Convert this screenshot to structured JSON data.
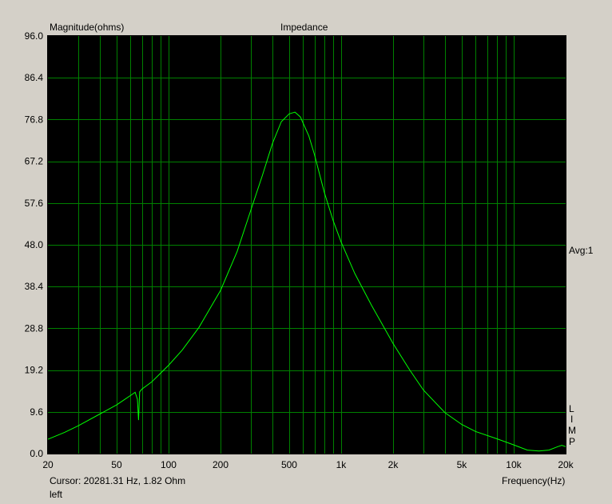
{
  "chart_data": {
    "type": "line",
    "title": "Impedance",
    "ylabel": "Magnitude(ohms)",
    "xlabel": "Frequency(Hz)",
    "x_scale": "log",
    "xlim": [
      20,
      20000
    ],
    "ylim": [
      0,
      96
    ],
    "grid": true,
    "y_ticks": [
      "0.0",
      "9.6",
      "19.2",
      "28.8",
      "38.4",
      "48.0",
      "57.6",
      "67.2",
      "76.8",
      "86.4",
      "96.0"
    ],
    "x_ticks": [
      {
        "value": 20,
        "label": "20"
      },
      {
        "value": 50,
        "label": "50"
      },
      {
        "value": 100,
        "label": "100"
      },
      {
        "value": 200,
        "label": "200"
      },
      {
        "value": 500,
        "label": "500"
      },
      {
        "value": 1000,
        "label": "1k"
      },
      {
        "value": 2000,
        "label": "2k"
      },
      {
        "value": 5000,
        "label": "5k"
      },
      {
        "value": 10000,
        "label": "10k"
      },
      {
        "value": 20000,
        "label": "20k"
      }
    ],
    "series": [
      {
        "color": "#00ff00",
        "points": [
          [
            20,
            3.3
          ],
          [
            25,
            4.9
          ],
          [
            30,
            6.4
          ],
          [
            40,
            9.1
          ],
          [
            50,
            11.2
          ],
          [
            55,
            12.3
          ],
          [
            62,
            13.7
          ],
          [
            64,
            14.1
          ],
          [
            66,
            12.5
          ],
          [
            67,
            7.7
          ],
          [
            68,
            14.2
          ],
          [
            70,
            14.8
          ],
          [
            80,
            16.5
          ],
          [
            90,
            18.5
          ],
          [
            100,
            20.3
          ],
          [
            120,
            23.8
          ],
          [
            150,
            29.0
          ],
          [
            200,
            37.5
          ],
          [
            250,
            46.5
          ],
          [
            300,
            56.0
          ],
          [
            350,
            64.0
          ],
          [
            400,
            71.3
          ],
          [
            450,
            76.3
          ],
          [
            500,
            78.1
          ],
          [
            540,
            78.5
          ],
          [
            580,
            77.4
          ],
          [
            650,
            73.0
          ],
          [
            700,
            68.8
          ],
          [
            800,
            60.0
          ],
          [
            900,
            53.5
          ],
          [
            1000,
            48.6
          ],
          [
            1200,
            41.4
          ],
          [
            1500,
            34.1
          ],
          [
            2000,
            25.3
          ],
          [
            2500,
            19.2
          ],
          [
            3000,
            14.6
          ],
          [
            4000,
            9.4
          ],
          [
            5000,
            6.7
          ],
          [
            6000,
            5.1
          ],
          [
            8000,
            3.4
          ],
          [
            10000,
            2.0
          ],
          [
            12000,
            0.8
          ],
          [
            14000,
            0.6
          ],
          [
            16000,
            0.8
          ],
          [
            18000,
            1.6
          ],
          [
            19000,
            1.9
          ],
          [
            20000,
            1.6
          ]
        ]
      }
    ]
  },
  "labels": {
    "magnitude": "Magnitude(ohms)",
    "title": "Impedance",
    "avg": "Avg:1",
    "lim_letters": [
      "L",
      "I",
      "M",
      "P"
    ],
    "cursor": "Cursor: 20281.31 Hz, 1.82 Ohm",
    "channel": "left",
    "frequency": "Frequency(Hz)"
  },
  "colors": {
    "background": "#d4d0c8",
    "plot_background": "#000000",
    "grid": "#008000",
    "trace": "#00ff00"
  }
}
